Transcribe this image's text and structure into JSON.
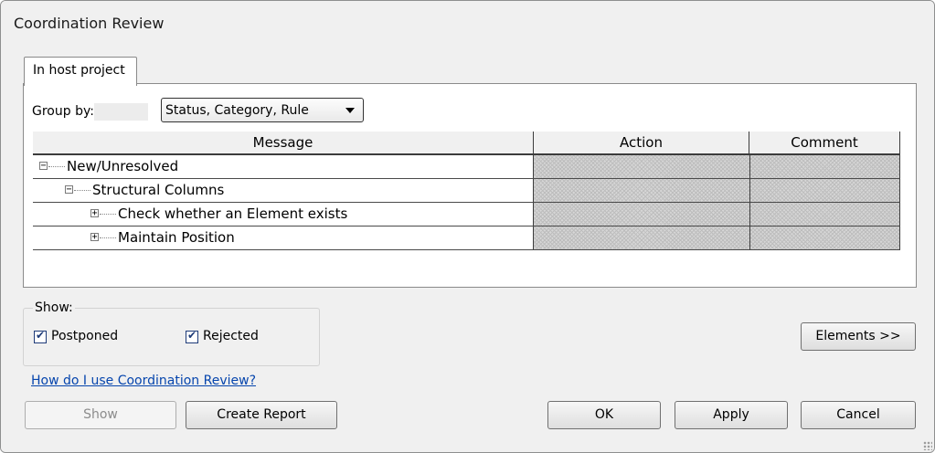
{
  "window": {
    "title": "Coordination Review"
  },
  "tab": {
    "label": "In host project"
  },
  "group_by": {
    "label": "Group by:",
    "value": "Status, Category, Rule"
  },
  "grid": {
    "columns": [
      "Message",
      "Action",
      "Comment"
    ],
    "rows": [
      {
        "text": "New/Unresolved",
        "expander": "−"
      },
      {
        "text": "Structural Columns",
        "expander": "−"
      },
      {
        "text": "Check whether an Element exists",
        "expander": "+"
      },
      {
        "text": "Maintain Position",
        "expander": "+"
      }
    ]
  },
  "show": {
    "label": "Show:",
    "postponed": {
      "label": "Postponed",
      "checked": true
    },
    "rejected": {
      "label": "Rejected",
      "checked": true
    }
  },
  "buttons": {
    "elements": "Elements >>",
    "show": "Show",
    "create_report": "Create Report",
    "ok": "OK",
    "apply": "Apply",
    "cancel": "Cancel"
  },
  "help_link": "How do I use Coordination Review?"
}
